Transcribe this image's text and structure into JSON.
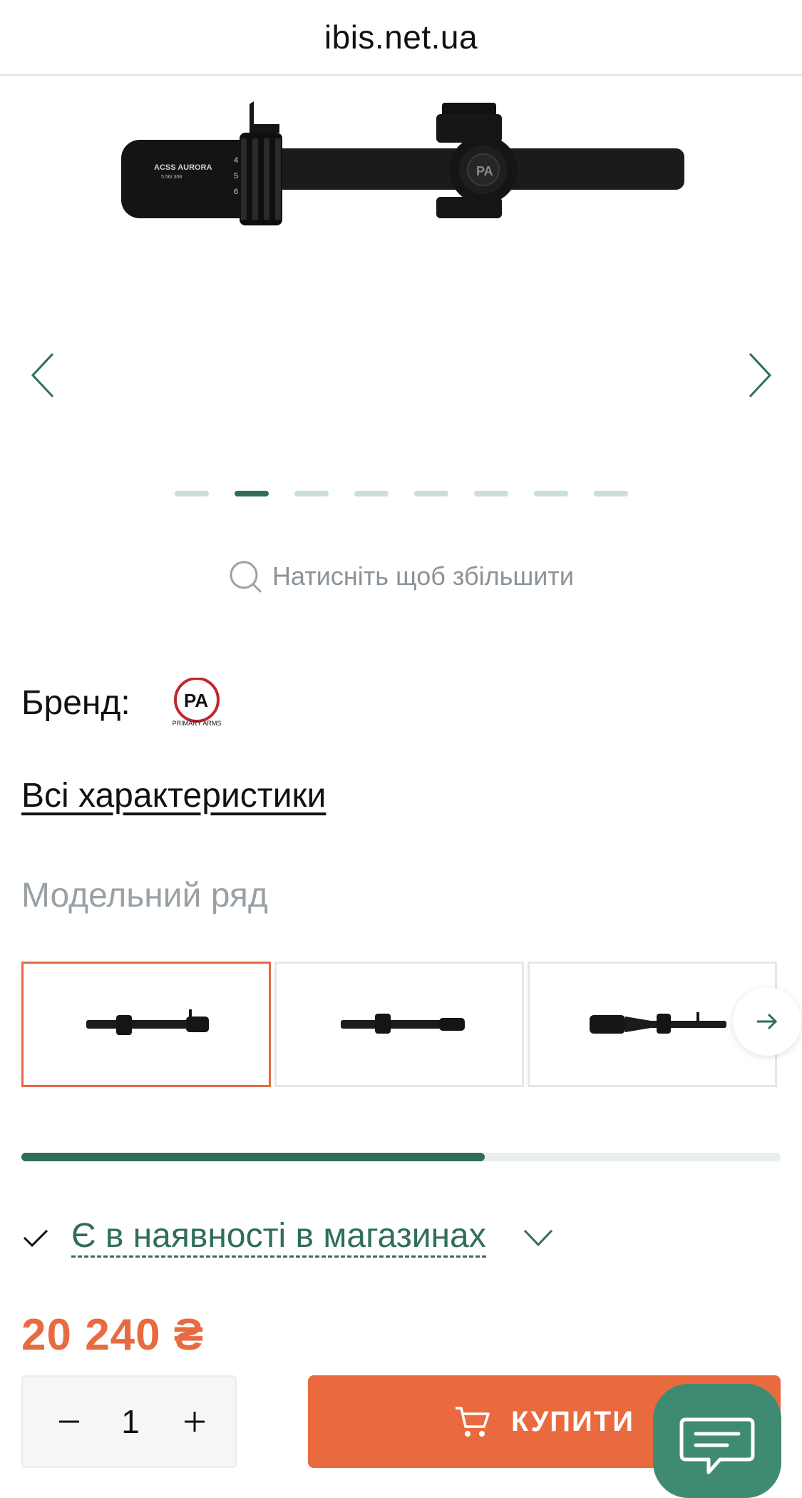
{
  "browser": {
    "url": "ibis.net.ua"
  },
  "gallery": {
    "slide_count": 8,
    "active_index": 1,
    "zoom_hint": "Натисніть щоб збільшити",
    "scope_markings": {
      "brand_text": "ACSS AURORA",
      "caliber_text": "5.56/.308",
      "cap_logo": "PA"
    }
  },
  "brand": {
    "label": "Бренд:",
    "logo_text": "PA",
    "logo_caption": "PRIMARY ARMS"
  },
  "all_specs_link": "Всі характеристики",
  "model_series": {
    "title": "Модельний ряд",
    "selected_index": 0,
    "items_visible": 3
  },
  "scroll_progress": 0.61,
  "availability": {
    "text": "Є в наявності в магазинах"
  },
  "price": "20 240 ₴",
  "quantity": {
    "value": "1",
    "minus": "−",
    "plus": "+"
  },
  "buy_button": {
    "label": "КУПИТИ"
  },
  "colors": {
    "accent": "#ea6a40",
    "brand_green": "#2f6e57",
    "dot_inactive": "#c9dfd8",
    "muted": "#9aa1a6"
  }
}
